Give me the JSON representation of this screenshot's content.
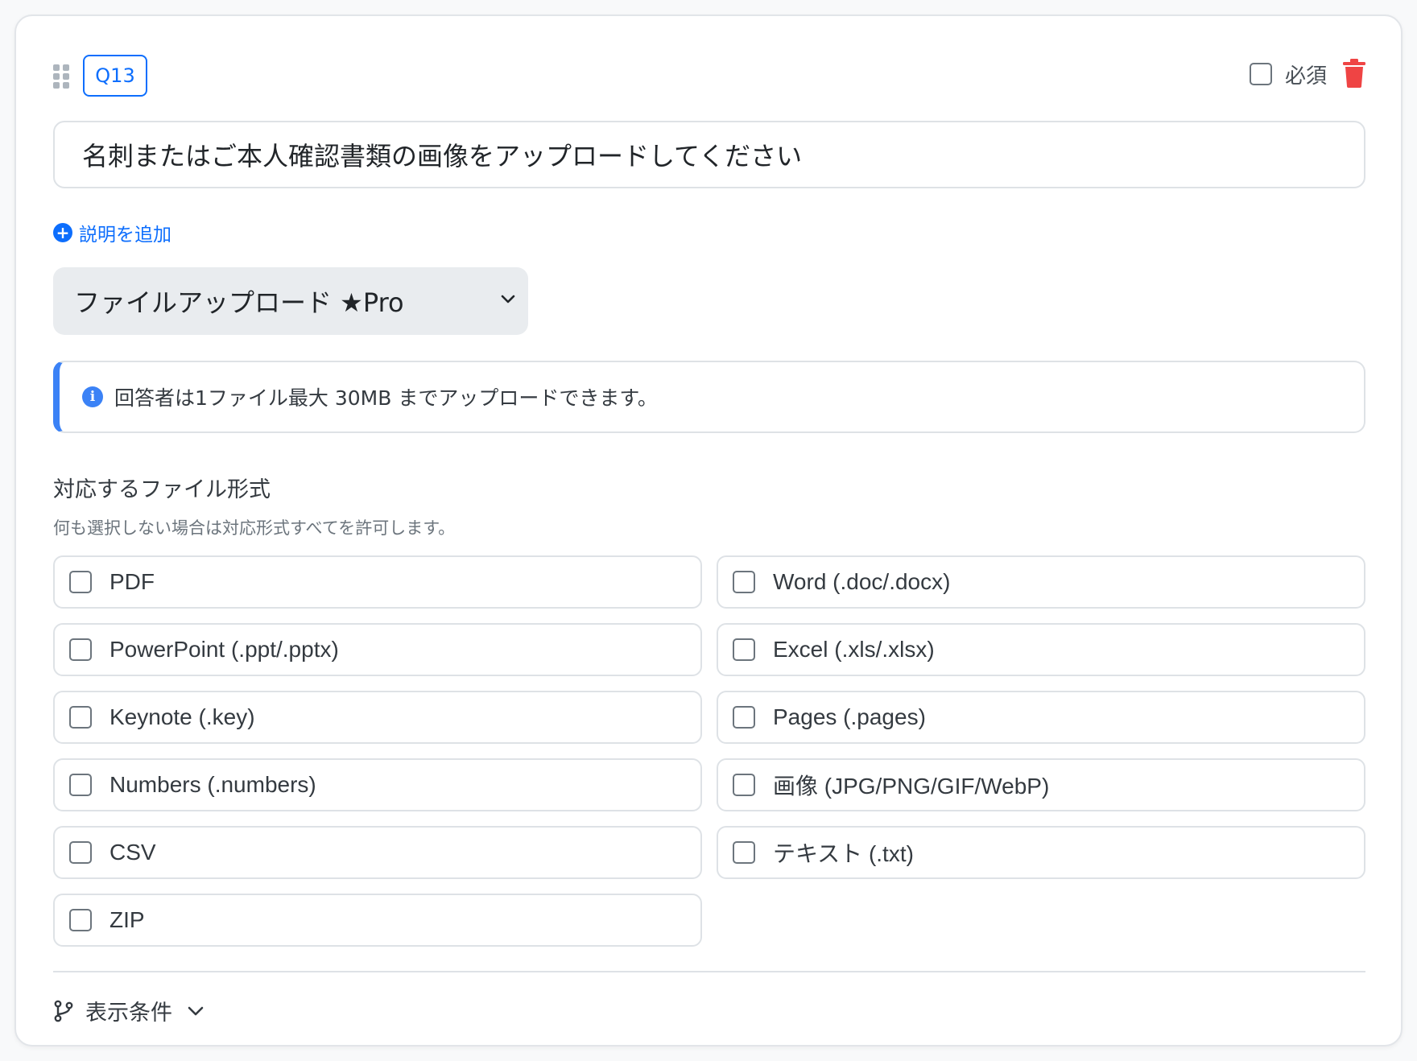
{
  "question": {
    "number": "Q13",
    "required_label": "必須",
    "title": "名刺またはご本人確認書類の画像をアップロードしてください",
    "add_description_label": "説明を追加",
    "type_selected": "ファイルアップロード ★Pro"
  },
  "info": {
    "text": "回答者は1ファイル最大 30MB までアップロードできます。"
  },
  "formats": {
    "heading": "対応するファイル形式",
    "help": "何も選択しない場合は対応形式すべてを許可します。",
    "options": [
      {
        "label": "PDF",
        "checked": false
      },
      {
        "label": "Word (.doc/.docx)",
        "checked": false
      },
      {
        "label": "PowerPoint (.ppt/.pptx)",
        "checked": false
      },
      {
        "label": "Excel (.xls/.xlsx)",
        "checked": false
      },
      {
        "label": "Keynote (.key)",
        "checked": false
      },
      {
        "label": "Pages (.pages)",
        "checked": false
      },
      {
        "label": "Numbers (.numbers)",
        "checked": false
      },
      {
        "label": "画像 (JPG/PNG/GIF/WebP)",
        "checked": false
      },
      {
        "label": "CSV",
        "checked": false
      },
      {
        "label": "テキスト (.txt)",
        "checked": false
      },
      {
        "label": "ZIP",
        "checked": false
      }
    ]
  },
  "conditions": {
    "label": "表示条件"
  },
  "colors": {
    "accent": "#0d6efd",
    "info_bar": "#3b82f6",
    "delete": "#ef4444"
  }
}
